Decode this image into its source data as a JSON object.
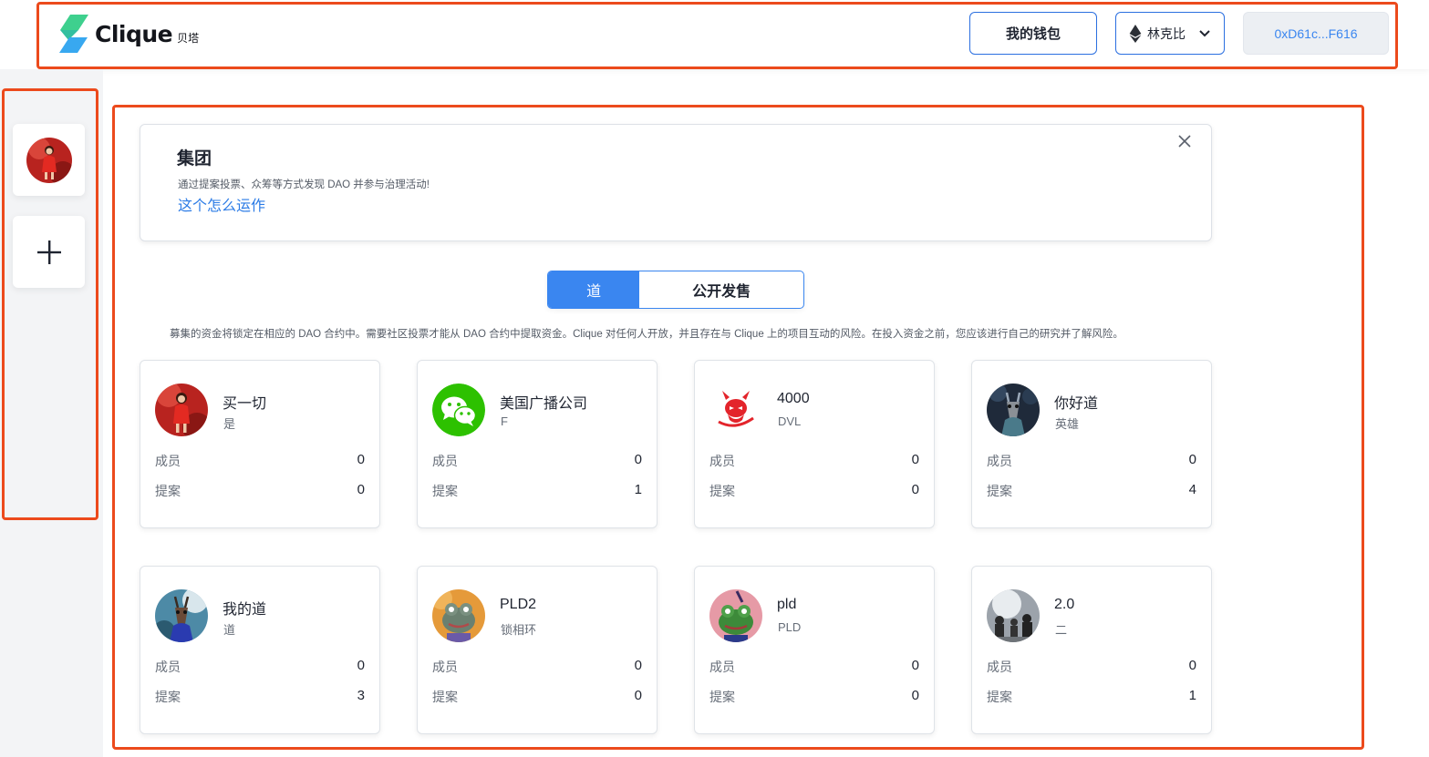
{
  "header": {
    "logo_text": "Clique",
    "logo_sub": "贝塔",
    "wallet_label": "我的钱包",
    "chain_label": "林克比",
    "address": "0xD61c...F616"
  },
  "sidebar": {
    "items": [
      {
        "name": "dao-avatar",
        "icon": "red-dress-avatar"
      },
      {
        "name": "add",
        "label": "+"
      }
    ]
  },
  "intro": {
    "title": "集团",
    "description": "通过提案投票、众筹等方式发现 DAO 并参与治理活动!",
    "link": "这个怎么运作"
  },
  "tabs": [
    {
      "label": "道",
      "active": true
    },
    {
      "label": "公开发售",
      "active": false
    }
  ],
  "notice": "募集的资金将锁定在相应的 DAO 合约中。需要社区投票才能从 DAO 合约中提取资金。Clique 对任何人开放，并且存在与 Clique 上的项目互动的风险。在投入资金之前，您应该进行自己的研究并了解风险。",
  "labels": {
    "members": "成员",
    "proposals": "提案"
  },
  "colors": {
    "accent": "#3a86f0",
    "annotation": "#ec4a1c"
  },
  "daos": [
    {
      "name": "买一切",
      "symbol": "是",
      "members": "0",
      "proposals": "0",
      "avatar": "red-dress"
    },
    {
      "name": "美国广播公司",
      "symbol": "F",
      "members": "0",
      "proposals": "1",
      "avatar": "wechat"
    },
    {
      "name": "4000",
      "symbol": "DVL",
      "members": "0",
      "proposals": "0",
      "avatar": "devil"
    },
    {
      "name": "你好道",
      "symbol": "英雄",
      "members": "0",
      "proposals": "4",
      "avatar": "giraffe"
    },
    {
      "name": "我的道",
      "symbol": "道",
      "members": "0",
      "proposals": "3",
      "avatar": "giraffe-blue"
    },
    {
      "name": "PLD2",
      "symbol": "锁相环",
      "members": "0",
      "proposals": "0",
      "avatar": "frog-orange"
    },
    {
      "name": "pld",
      "symbol": "PLD",
      "members": "0",
      "proposals": "0",
      "avatar": "frog-pink"
    },
    {
      "name": "2.0",
      "symbol": "二",
      "members": "0",
      "proposals": "1",
      "avatar": "photo-people"
    }
  ]
}
